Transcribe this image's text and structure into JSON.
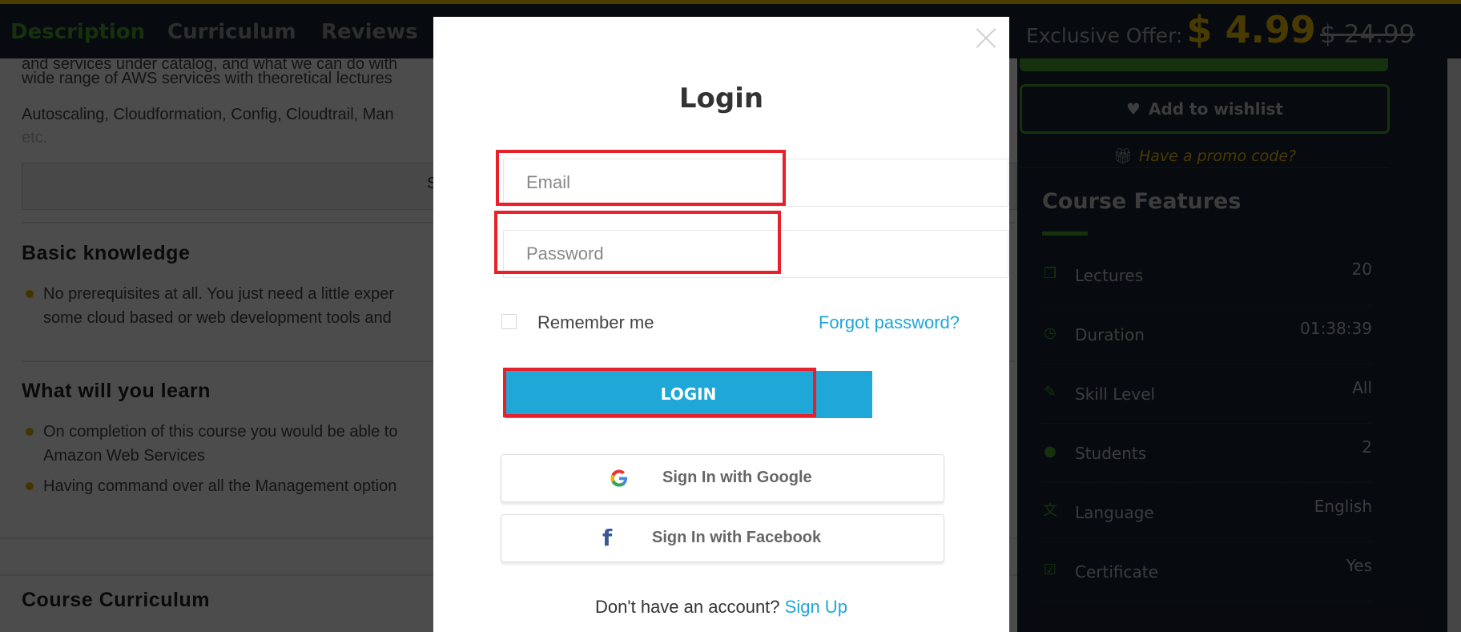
{
  "nav": {
    "tabs": [
      {
        "label": "Description",
        "active": true
      },
      {
        "label": "Curriculum",
        "active": false
      },
      {
        "label": "Reviews",
        "active": false
      }
    ]
  },
  "content": {
    "para1_line1": "and services under catalog, and what we can do with",
    "para1_line2": "wide range of AWS services with theoretical lectures",
    "para2_line1": "Autoscaling, Cloudformation, Config, Cloudtrail, Man",
    "para2_line2": "etc.",
    "show_more_label": "S",
    "basic_knowledge": {
      "heading": "Basic knowledge",
      "items": [
        "No prerequisites at all. You just need a little exper",
        "some cloud based or web development tools and"
      ]
    },
    "what_you_learn": {
      "heading": "What will you learn",
      "items": [
        {
          "line1": "On completion of this course you would be able to",
          "line2": "Amazon Web Services"
        },
        {
          "line1": "Having command over all the Management option",
          "line2": ""
        }
      ]
    },
    "curriculum_heading": "Course Curriculum"
  },
  "sidebar": {
    "offer_label": "Exclusive Offer:",
    "price": "$ 4.99",
    "old_price": "$ 24.99",
    "wishlist_label": "Add to wishlist",
    "promo_label": "Have a promo code?",
    "features_title": "Course Features",
    "features": [
      {
        "icon": "copy-icon",
        "glyph": "❐",
        "name": "Lectures",
        "value": "20"
      },
      {
        "icon": "clock-icon",
        "glyph": "◷",
        "name": "Duration",
        "value": "01:38:39"
      },
      {
        "icon": "magic-wand-icon",
        "glyph": "✎",
        "name": "Skill Level",
        "value": "All"
      },
      {
        "icon": "user-icon",
        "glyph": "●",
        "name": "Students",
        "value": "2"
      },
      {
        "icon": "language-icon",
        "glyph": "文",
        "name": "Language",
        "value": "English"
      },
      {
        "icon": "checkbox-icon",
        "glyph": "☑",
        "name": "Certificate",
        "value": "Yes"
      }
    ],
    "colors": {
      "accent_green": "#4ca62d",
      "price_yellow": "#f2c200"
    }
  },
  "modal": {
    "title": "Login",
    "email_placeholder": "Email",
    "password_placeholder": "Password",
    "remember_label": "Remember me",
    "forgot_label": "Forgot password?",
    "login_label": "LOGIN",
    "google_label": "Sign In with Google",
    "facebook_label": "Sign In with Facebook",
    "no_account_text": "Don't have an account?",
    "signup_label": "Sign Up",
    "colors": {
      "button_blue": "#1ea7d7",
      "highlight_red": "#e8202a"
    }
  }
}
